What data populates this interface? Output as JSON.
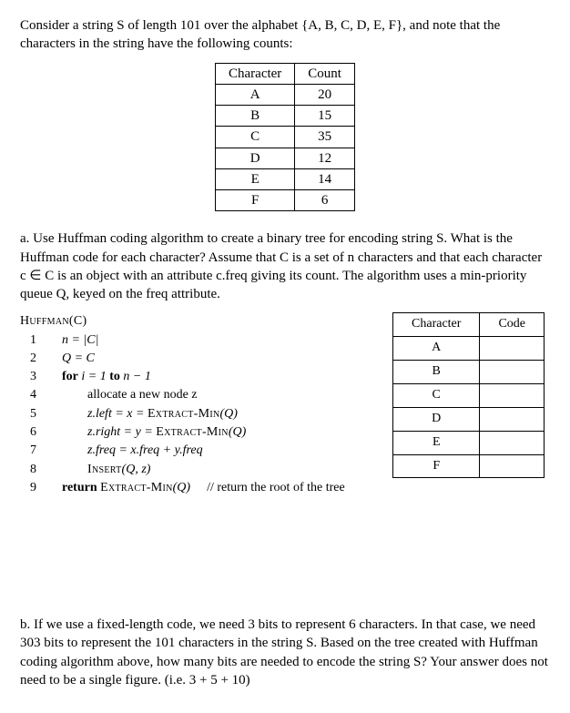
{
  "intro": "Consider a string S of length 101 over the alphabet {A, B, C, D, E, F}, and note that the characters in the string have the following counts:",
  "count_table": {
    "head_char": "Character",
    "head_count": "Count",
    "rows": [
      {
        "ch": "A",
        "ct": "20"
      },
      {
        "ch": "B",
        "ct": "15"
      },
      {
        "ch": "C",
        "ct": "35"
      },
      {
        "ch": "D",
        "ct": "12"
      },
      {
        "ch": "E",
        "ct": "14"
      },
      {
        "ch": "F",
        "ct": "6"
      }
    ]
  },
  "part_a": "a.  Use Huffman coding algorithm to create a binary tree for encoding string S.  What is the Huffman code for each character? Assume that C is a set of n characters and that each character c ∈ C is an object with an attribute c.freq giving its count. The algorithm uses a min-priority queue Q, keyed on the freq attribute.",
  "algo": {
    "title": "Huffman(C)",
    "l1": "n = |C|",
    "l2": "Q = C",
    "l3_kw": "for",
    "l3_rest": " i = 1 ",
    "l3_kw2": "to",
    "l3_rest2": " n − 1",
    "l4": "allocate a new node z",
    "l5a": "z.left = x = ",
    "l5b": "Extract-Min",
    "l5c": "(Q)",
    "l6a": "z.right = y = ",
    "l6b": "Extract-Min",
    "l6c": "(Q)",
    "l7": "z.freq = x.freq + y.freq",
    "l8a": "Insert",
    "l8b": "(Q, z)",
    "l9_kw": "return ",
    "l9a": "Extract-Min",
    "l9b": "(Q)",
    "l9_comment": "// return the root of the tree"
  },
  "code_table": {
    "head_char": "Character",
    "head_code": "Code",
    "rows": [
      {
        "ch": "A",
        "cd": ""
      },
      {
        "ch": "B",
        "cd": ""
      },
      {
        "ch": "C",
        "cd": ""
      },
      {
        "ch": "D",
        "cd": ""
      },
      {
        "ch": "E",
        "cd": ""
      },
      {
        "ch": "F",
        "cd": ""
      }
    ]
  },
  "part_b": "b. If we use a fixed-length code, we need 3 bits to represent 6 characters.  In that case, we need 303 bits to represent the 101 characters in the string S. Based on the tree created with Huffman coding algorithm above, how many bits are needed to encode the string S?  Your answer does not need to be a single figure.  (i.e. 3 + 5 + 10)"
}
